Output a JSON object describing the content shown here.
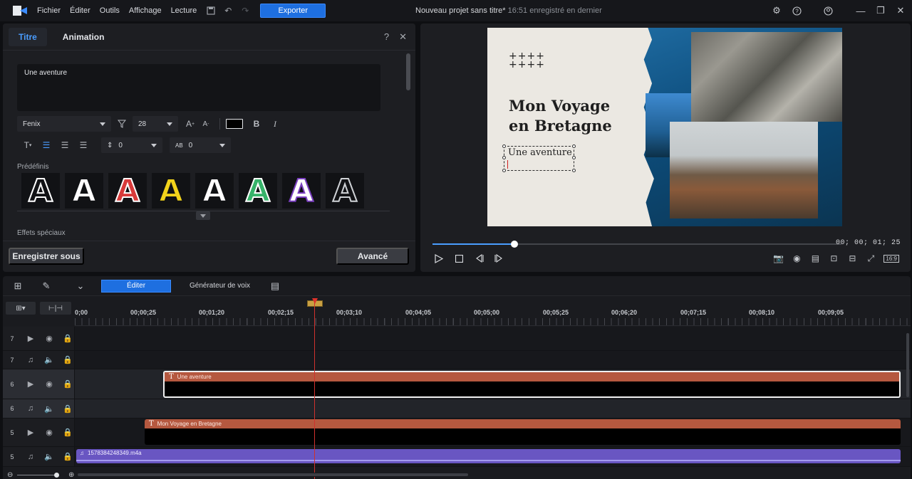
{
  "topbar": {
    "menu": [
      "Fichier",
      "Éditer",
      "Outils",
      "Affichage",
      "Lecture"
    ],
    "export_label": "Exporter",
    "project_title": "Nouveau projet sans titre*",
    "saved_status": "16:51 enregistré en dernier",
    "accent": "#1e6fe0"
  },
  "title_panel": {
    "tabs": [
      "Titre",
      "Animation"
    ],
    "help": "?",
    "close": "✕",
    "text_value": "Une aventure",
    "font_name": "Fenix",
    "font_size": "28",
    "line_spacing": "0",
    "char_spacing": "0",
    "presets_label": "Prédéfinis",
    "effects_label": "Effets spéciaux",
    "presets": [
      {
        "glyph": "A",
        "fill": "#111215",
        "stroke": "#ffffff"
      },
      {
        "glyph": "A",
        "fill": "#ffffff",
        "stroke": "#111215"
      },
      {
        "glyph": "A",
        "fill": "#d83a3a",
        "stroke": "#ffffff"
      },
      {
        "glyph": "A",
        "fill": "#f2d31b",
        "stroke": "#111215"
      },
      {
        "glyph": "A",
        "fill": "#ffffff",
        "stroke": "#111215"
      },
      {
        "glyph": "A",
        "fill": "#37b36a",
        "stroke": "#ffffff"
      },
      {
        "glyph": "A",
        "fill": "#ffffff",
        "stroke": "#7a3fc0"
      },
      {
        "glyph": "A",
        "fill": "#111215",
        "stroke": "#cfd2d6"
      }
    ],
    "save_as_label": "Enregistrer sous",
    "advanced_label": "Avancé"
  },
  "preview": {
    "plus_rows": [
      "++++",
      "++++"
    ],
    "title_line1": "Mon Voyage",
    "title_line2": "en Bretagne",
    "selected_text": "Une aventure",
    "timecode": "00; 00; 01; 25",
    "progress_fraction": 0.2,
    "aspect_ratio": "16:9"
  },
  "timeline": {
    "edit_label": "Éditer",
    "voice_label": "Générateur de voix",
    "ruler_labels": [
      "0;00",
      "00;00;25",
      "00;01;20",
      "00;02;15",
      "00;03;10",
      "00;04;05",
      "00;05;00",
      "00;05;25",
      "00;06;20",
      "00;07;15",
      "00;08;10",
      "00;09;05"
    ],
    "tracks": [
      {
        "num": "7",
        "type": "video"
      },
      {
        "num": "7",
        "type": "audio"
      },
      {
        "num": "6",
        "type": "video"
      },
      {
        "num": "6",
        "type": "audio"
      },
      {
        "num": "5",
        "type": "video"
      },
      {
        "num": "5",
        "type": "audio"
      }
    ],
    "clips": {
      "title_clip_1": "Une aventure",
      "title_clip_2": "Mon Voyage en Bretagne",
      "audio_clip": "1578384248349.m4a"
    }
  }
}
